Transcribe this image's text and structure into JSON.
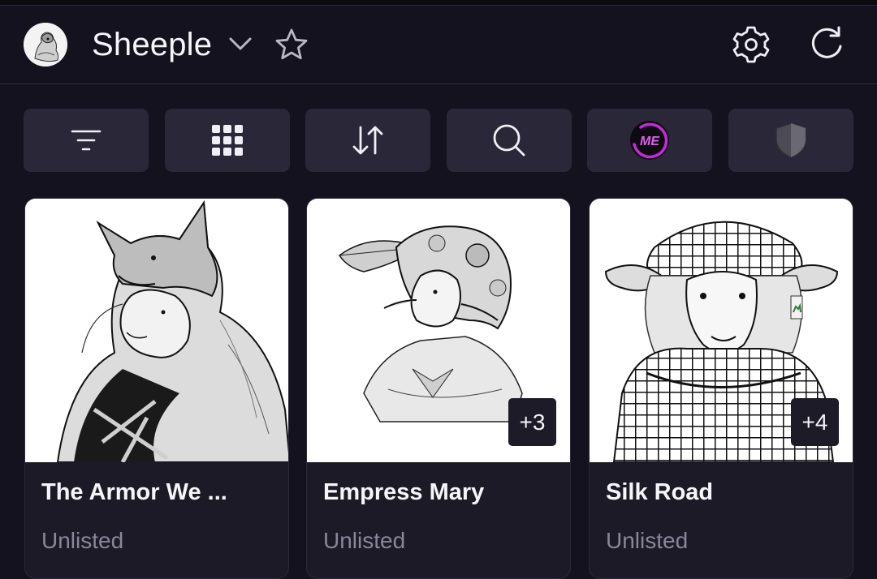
{
  "header": {
    "title": "Sheeple"
  },
  "toolbar": {
    "buttons": [
      {
        "name": "filter-button",
        "icon": "filter-icon"
      },
      {
        "name": "grid-view-button",
        "icon": "grid-icon"
      },
      {
        "name": "sort-button",
        "icon": "sort-arrows-icon"
      },
      {
        "name": "search-button",
        "icon": "search-icon"
      },
      {
        "name": "magic-eden-button",
        "icon": "magic-eden-logo-icon"
      },
      {
        "name": "shield-button",
        "icon": "shield-icon"
      }
    ]
  },
  "cards": [
    {
      "name": "The Armor We ...",
      "status": "Unlisted",
      "badge": null,
      "art": "wolf-cloaked-sheep"
    },
    {
      "name": "Empress Mary",
      "status": "Unlisted",
      "badge": "+3",
      "art": "sheep-in-wig-with-feather"
    },
    {
      "name": "Silk Road",
      "status": "Unlisted",
      "badge": "+4",
      "art": "sheep-with-keffiyeh"
    }
  ],
  "colors": {
    "background": "#14121e",
    "button": "#2a2838",
    "card": "#1c1a27",
    "muted_text": "#8a8799",
    "accent_magenta": "#c42bd8"
  }
}
